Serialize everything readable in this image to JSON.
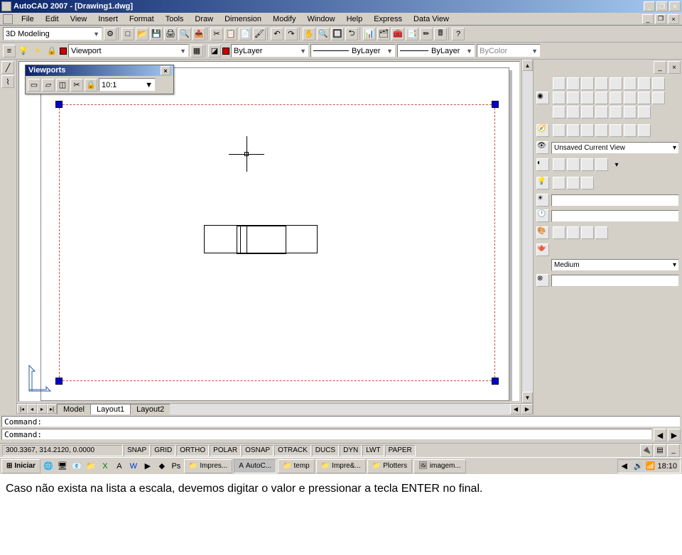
{
  "title_bar": {
    "text": "AutoCAD 2007 - [Drawing1.dwg]"
  },
  "menu": [
    "File",
    "Edit",
    "View",
    "Insert",
    "Format",
    "Tools",
    "Draw",
    "Dimension",
    "Modify",
    "Window",
    "Help",
    "Express",
    "Data View"
  ],
  "workspace_select": "3D Modeling",
  "layer_combo": "Viewport",
  "linetype_combo": "ByLayer",
  "lineweight_combo": "ByLayer",
  "plotstyle_combo": "ByLayer",
  "color_combo": "ByColor",
  "viewports_panel": {
    "title": "Viewports",
    "scale": "10:1"
  },
  "right_view_combo": "Unsaved Current View",
  "right_visual_combo": "Medium",
  "tabs": [
    "Model",
    "Layout1",
    "Layout2"
  ],
  "command_prompt": "Command:",
  "status": {
    "coords": "300.3367, 314.2120, 0.0000",
    "toggles": [
      "SNAP",
      "GRID",
      "ORTHO",
      "POLAR",
      "OSNAP",
      "OTRACK",
      "DUCS",
      "DYN",
      "LWT",
      "PAPER"
    ]
  },
  "taskbar": {
    "start": "Iniciar",
    "apps": [
      "Impres...",
      "AutoC...",
      "temp",
      "Impre&...",
      "Plotters",
      "imagem..."
    ],
    "clock": "18:10"
  },
  "article": "Caso não exista na lista a escala, devemos digitar o valor e pressionar a tecla ENTER no final."
}
